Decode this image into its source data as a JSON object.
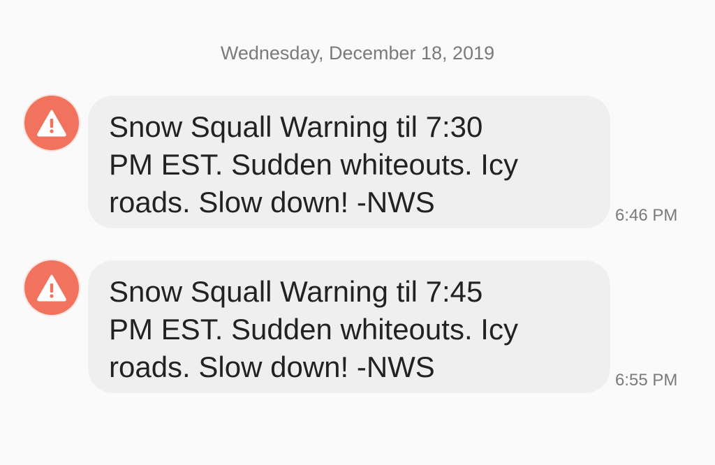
{
  "conversation": {
    "date_header": "Wednesday, December 18, 2019",
    "messages": [
      {
        "icon": "warning-triangle-icon",
        "text": "Snow Squall Warning til 7:30\nPM EST. Sudden whiteouts. Icy\nroads. Slow down! -NWS",
        "time": "6:46 PM"
      },
      {
        "icon": "warning-triangle-icon",
        "text": "Snow Squall Warning til 7:45\nPM EST. Sudden whiteouts. Icy\nroads. Slow down! -NWS",
        "time": "6:55 PM"
      }
    ]
  },
  "colors": {
    "alert_icon_bg": "#f2735d",
    "bubble_bg": "#efefef",
    "page_bg": "#fafafa"
  }
}
